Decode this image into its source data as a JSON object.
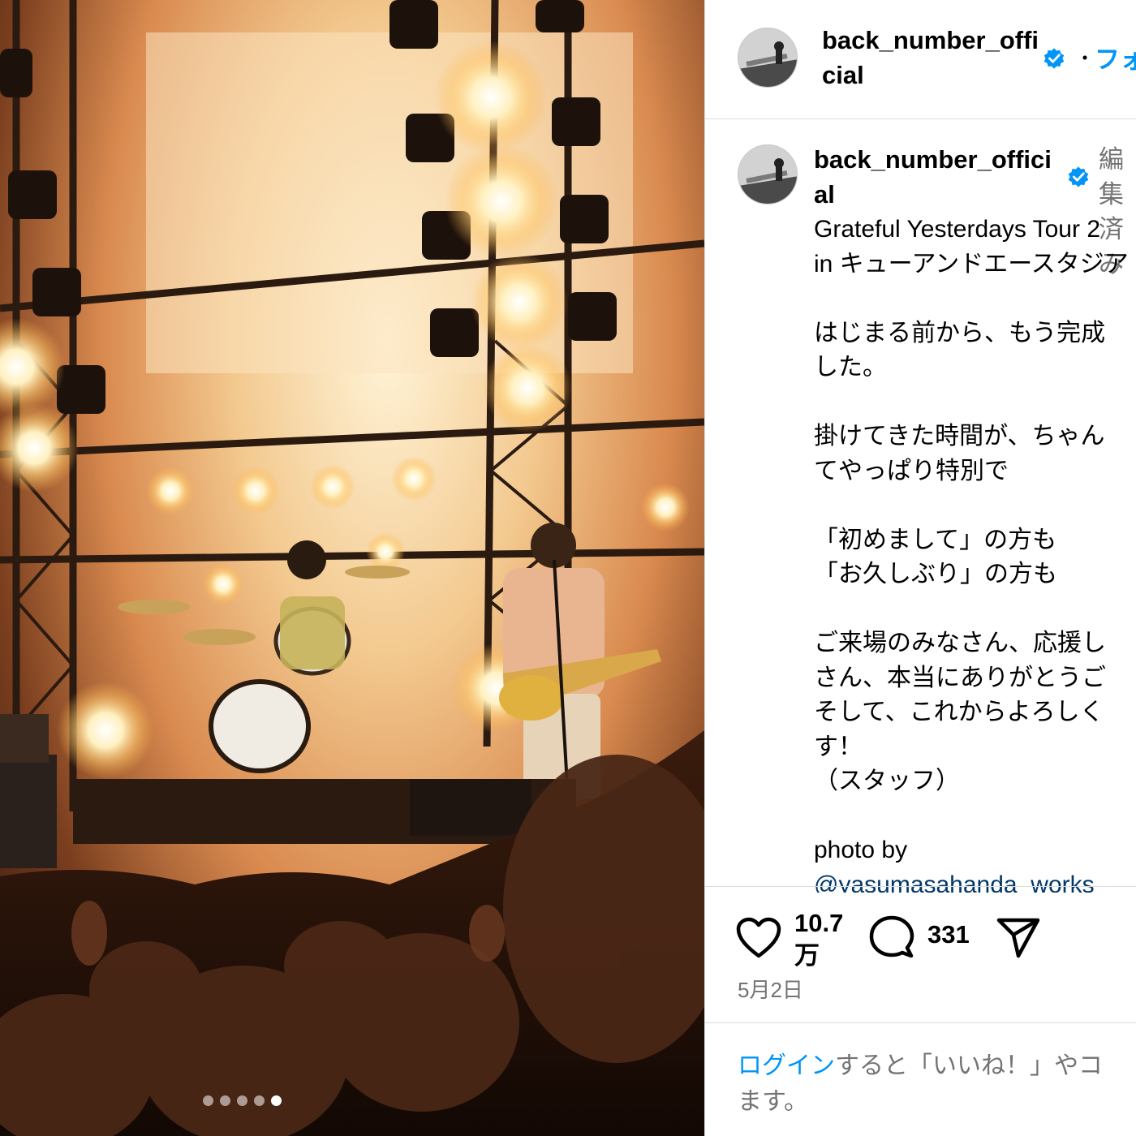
{
  "post": {
    "username": "back_number_official",
    "follow_label": "フォ",
    "separator": "・",
    "edited_label": "編集済み",
    "caption_lines": [
      "Grateful Yesterdays Tour 2",
      "in キューアンドエースタジア",
      "",
      "はじまる前から、もう完成",
      "した。",
      "",
      "掛けてきた時間が、ちゃん",
      "てやっぱり特別で",
      "",
      "「初めまして」の方も",
      "「お久しぶり」の方も",
      "",
      "ご来場のみなさん、応援し",
      "さん、本当にありがとうご",
      "そして、これからよろしく",
      "す！",
      "（スタッフ）",
      "",
      "photo by"
    ],
    "mention": "@yasumasahanda_works",
    "likes": "10.7万",
    "comments": "331",
    "date": "5月2日",
    "login_link": "ログイン",
    "login_rest": "すると「いいね！」やコ",
    "login_rest2": "ます。"
  },
  "carousel": {
    "count": 5,
    "active_index": 4
  },
  "icons": {
    "verified": "verified-badge-icon",
    "like": "heart-icon",
    "comment": "comment-bubble-icon",
    "share": "paper-plane-icon"
  },
  "colors": {
    "link_blue": "#0095f6",
    "mention_blue": "#00376b",
    "muted_gray": "#737373",
    "verified_blue": "#0095f6",
    "divider": "#dbdbdb"
  }
}
